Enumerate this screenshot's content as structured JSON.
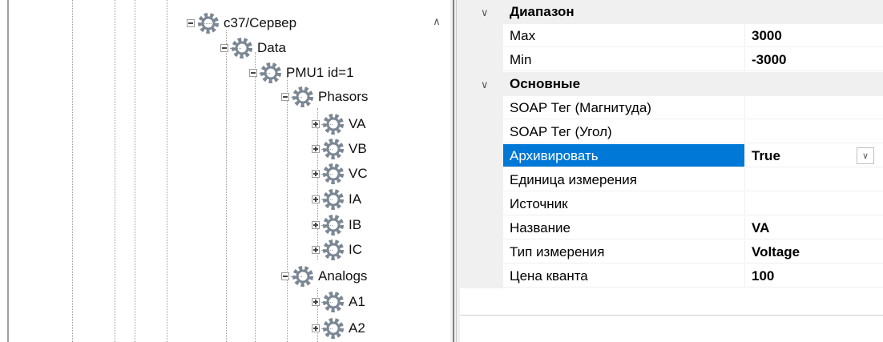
{
  "tree": {
    "root": "c37/Сервер",
    "data": "Data",
    "pmu": "PMU1 id=1",
    "phasors": "Phasors",
    "phasor_items": [
      "VA",
      "VB",
      "VC",
      "IA",
      "IB",
      "IC"
    ],
    "analogs": "Analogs",
    "analog_items": [
      "A1",
      "A2"
    ]
  },
  "properties": {
    "range": {
      "title": "Диапазон",
      "rows": [
        {
          "name": "Max",
          "value": "3000"
        },
        {
          "name": "Min",
          "value": "-3000"
        }
      ]
    },
    "main": {
      "title": "Основные",
      "rows": [
        {
          "name": "SOAP Тег (Магнитуда)",
          "value": ""
        },
        {
          "name": "SOAP Тег (Угол)",
          "value": ""
        },
        {
          "name": "Архивировать",
          "value": "True"
        },
        {
          "name": "Единица измерения",
          "value": ""
        },
        {
          "name": "Источник",
          "value": ""
        },
        {
          "name": "Название",
          "value": "VA"
        },
        {
          "name": "Тип измерения",
          "value": "Voltage"
        },
        {
          "name": "Цена кванта",
          "value": "100"
        }
      ]
    },
    "selected_row": "Архивировать"
  },
  "colors": {
    "selection": "#0078d7",
    "gear": "#7b8794",
    "category_bg": "#f0f0f0"
  },
  "icons": [
    "gear-icon",
    "expand-icon",
    "collapse-icon",
    "chevron-down-icon",
    "scroll-up-icon",
    "dropdown-icon"
  ]
}
